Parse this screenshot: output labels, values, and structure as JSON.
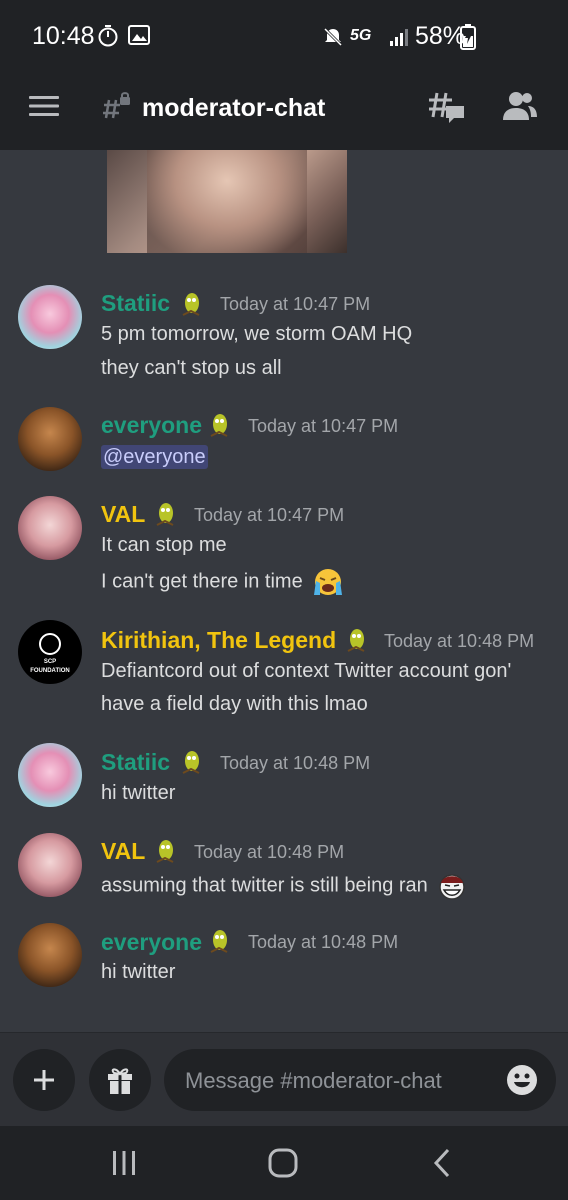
{
  "status_bar": {
    "time": "10:48",
    "network": "5G",
    "battery": "58%"
  },
  "header": {
    "channel_name": "moderator-chat"
  },
  "colors": {
    "teal_name": "#1f9e7f",
    "gold_name": "#f1c40f",
    "background": "#36393f",
    "header_bg": "#202225"
  },
  "messages": [
    {
      "author": "Statiic",
      "author_color": "#1f9e7f",
      "timestamp": "Today at 10:47 PM",
      "lines": [
        "5 pm tomorrow, we storm OAM HQ",
        "they can't stop us all"
      ]
    },
    {
      "author": "everyone",
      "author_color": "#1f9e7f",
      "timestamp": "Today at 10:47 PM",
      "lines": [
        "@everyone"
      ]
    },
    {
      "author": "VAL",
      "author_color": "#f1c40f",
      "timestamp": "Today at 10:47 PM",
      "lines": [
        "It can stop me",
        "I can't get there in time"
      ]
    },
    {
      "author": "Kirithian, The Legend",
      "author_color": "#f1c40f",
      "timestamp": "Today at 10:48 PM",
      "avatar_text_1": "SCP",
      "avatar_text_2": "FOUNDATION",
      "lines": [
        "Defiantcord out of context Twitter account gon'",
        "have a field day with this lmao"
      ]
    },
    {
      "author": "Statiic",
      "author_color": "#1f9e7f",
      "timestamp": "Today at 10:48 PM",
      "lines": [
        "hi twitter"
      ]
    },
    {
      "author": "VAL",
      "author_color": "#f1c40f",
      "timestamp": "Today at 10:48 PM",
      "lines": [
        "assuming that twitter is still being ran"
      ]
    },
    {
      "author": "everyone",
      "author_color": "#1f9e7f",
      "timestamp": "Today at 10:48 PM",
      "lines": [
        "hi twitter"
      ]
    }
  ],
  "composer": {
    "placeholder": "Message #moderator-chat"
  },
  "icons": {
    "hamburger": "menu-icon",
    "channel": "locked-hashtag-icon",
    "threads": "threads-icon",
    "members": "members-icon",
    "add": "plus-icon",
    "gift": "gift-icon",
    "emoji": "emoji-icon",
    "badge": "pickle-emoji-badge",
    "crying": "crying-emoji",
    "troll": "trollface-emoji"
  }
}
